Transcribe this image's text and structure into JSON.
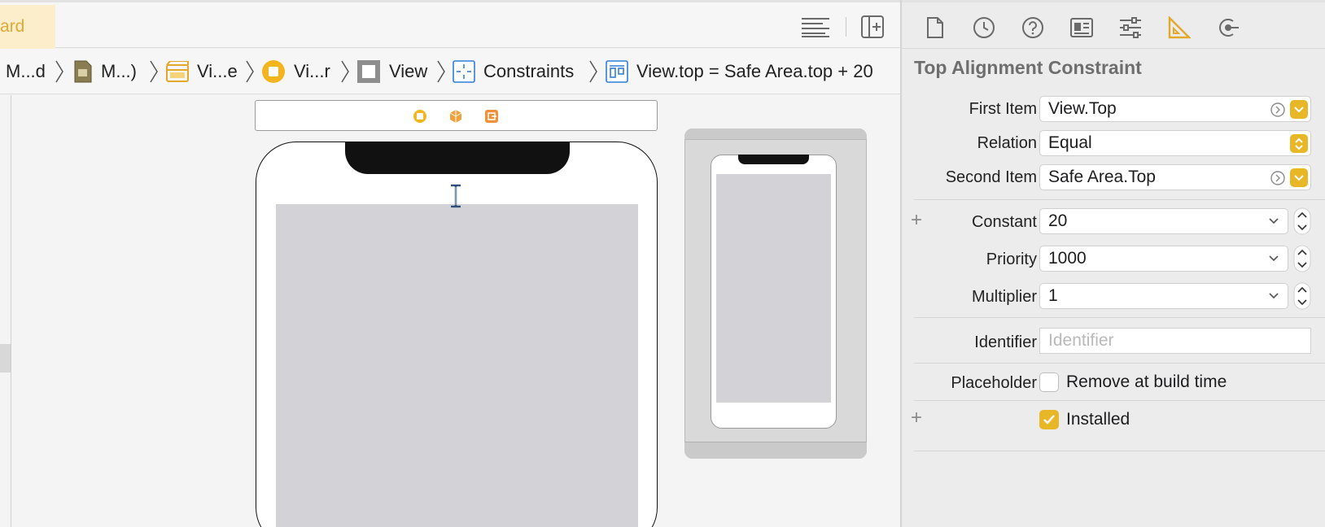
{
  "editor": {
    "active_tab_label": "ard",
    "jumpbar": [
      {
        "label": "M...d",
        "icon": "folder-icon"
      },
      {
        "label": "M...)",
        "icon": "storyboard-file-icon"
      },
      {
        "label": "Vi...e",
        "icon": "scene-icon"
      },
      {
        "label": "Vi...r",
        "icon": "view-controller-icon"
      },
      {
        "label": "View",
        "icon": "view-icon"
      },
      {
        "label": "Constraints",
        "icon": "constraints-icon"
      },
      {
        "label": "View.top = Safe Area.top + 20",
        "icon": "constraint-icon"
      }
    ]
  },
  "inspector": {
    "title": "Top Alignment Constraint",
    "first_item": {
      "label": "First Item",
      "value": "View.Top"
    },
    "relation": {
      "label": "Relation",
      "value": "Equal"
    },
    "second_item": {
      "label": "Second Item",
      "value": "Safe Area.Top"
    },
    "constant": {
      "label": "Constant",
      "value": "20"
    },
    "priority": {
      "label": "Priority",
      "value": "1000"
    },
    "multiplier": {
      "label": "Multiplier",
      "value": "1"
    },
    "identifier": {
      "label": "Identifier",
      "placeholder": "Identifier"
    },
    "placeholder": {
      "label": "Placeholder",
      "checkbox_label": "Remove at build time",
      "checked": false
    },
    "installed": {
      "checkbox_label": "Installed",
      "checked": true
    },
    "plus_symbol": "+"
  },
  "colors": {
    "accent": "#e8b728",
    "canvas_view": "#d3d3d7",
    "constraint_blue": "#2f7fd9"
  }
}
